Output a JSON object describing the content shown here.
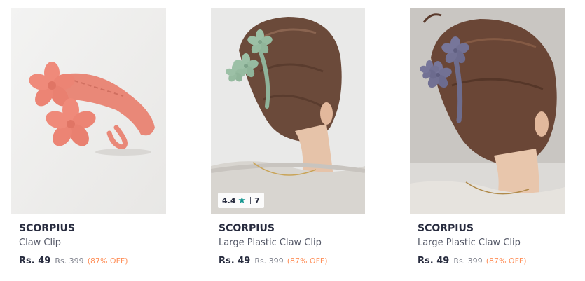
{
  "products": [
    {
      "brand": "SCORPIUS",
      "name": "Claw Clip",
      "price": "Rs. 49",
      "mrp": "Rs. 399",
      "discount": "(87% OFF)",
      "image": "pink-flower-claw-clip"
    },
    {
      "brand": "SCORPIUS",
      "name": "Large Plastic Claw Clip",
      "price": "Rs. 49",
      "mrp": "Rs. 399",
      "discount": "(87% OFF)",
      "image": "green-flower-claw-clip-in-hair",
      "rating": {
        "value": "4.4",
        "count": "7",
        "icon": "star-icon"
      }
    },
    {
      "brand": "SCORPIUS",
      "name": "Large Plastic Claw Clip",
      "price": "Rs. 49",
      "mrp": "Rs. 399",
      "discount": "(87% OFF)",
      "image": "purple-flower-claw-clip-in-hair"
    }
  ],
  "colors": {
    "brand_text": "#282c3f",
    "name_text": "#535766",
    "mrp_text": "#7e818c",
    "discount_text": "#ff905a",
    "rating_star": "#14958f"
  }
}
